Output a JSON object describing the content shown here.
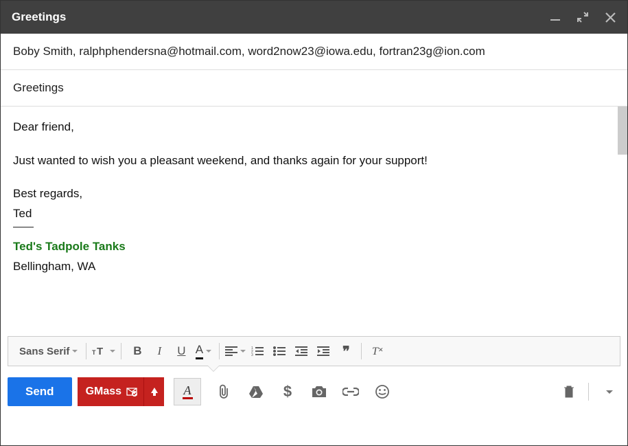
{
  "window": {
    "title": "Greetings"
  },
  "to": "Boby Smith, ralphphendersna@hotmail.com, word2now23@iowa.edu, fortran23g@ion.com",
  "subject": "Greetings",
  "body": {
    "greeting": "Dear friend,",
    "line1": "Just wanted to wish you a pleasant weekend, and thanks again for your support!",
    "closing": "Best regards,",
    "name": "Ted",
    "sig_company": "Ted's Tadpole Tanks",
    "sig_location": "Bellingham, WA"
  },
  "toolbar": {
    "font": "Sans Serif"
  },
  "buttons": {
    "send": "Send",
    "gmass": "GMass"
  }
}
